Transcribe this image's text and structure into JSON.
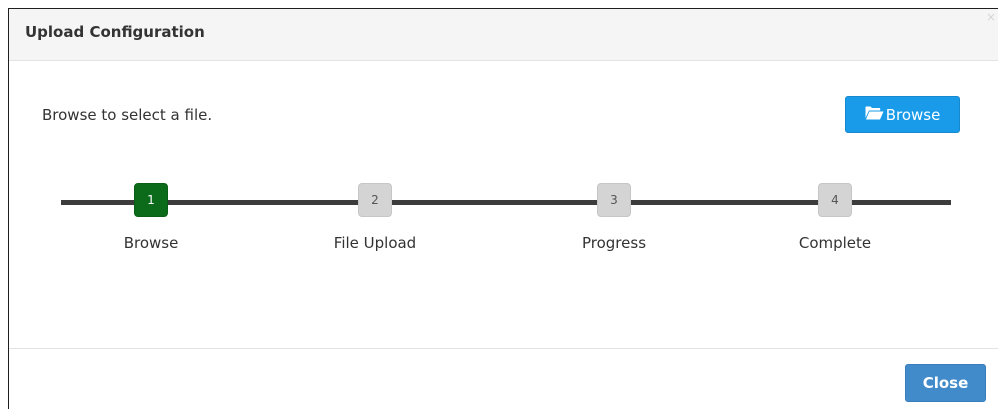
{
  "dialog": {
    "title": "Upload Configuration",
    "close_icon_glyph": "×"
  },
  "body": {
    "instruction": "Browse to select a file.",
    "browse_button": {
      "label": "Browse",
      "icon": "folder-open-icon",
      "color": "#1a9bea"
    }
  },
  "stepper": {
    "current_step": 1,
    "active_color": "#0b6b1a",
    "inactive_color": "#d4d4d4",
    "track_color": "#3c3c3c",
    "steps": [
      {
        "number": "1",
        "label": "Browse"
      },
      {
        "number": "2",
        "label": "File Upload"
      },
      {
        "number": "3",
        "label": "Progress"
      },
      {
        "number": "4",
        "label": "Complete"
      }
    ]
  },
  "footer": {
    "close_button": {
      "label": "Close",
      "color": "#428bca"
    }
  }
}
